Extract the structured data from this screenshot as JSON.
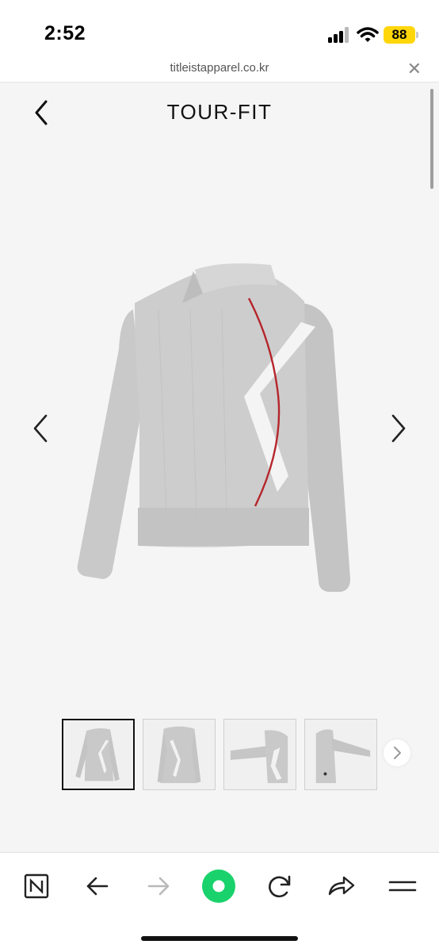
{
  "status_bar": {
    "time": "2:52",
    "battery": "88",
    "battery_color": "#ffd60a"
  },
  "browser": {
    "url": "titleistapparel.co.kr",
    "close_icon": "close-icon"
  },
  "header": {
    "title": "TOUR-FIT",
    "back_icon": "chevron-left-icon"
  },
  "gallery": {
    "product": "sweater",
    "prev_icon": "chevron-left-icon",
    "next_icon": "chevron-right-icon",
    "thumbnails": [
      {
        "view": "front",
        "active": true
      },
      {
        "view": "back",
        "active": false
      },
      {
        "view": "side-arm",
        "active": false
      },
      {
        "view": "side",
        "active": false
      }
    ],
    "more_icon": "chevron-right-icon"
  },
  "toolbar": {
    "items": [
      "naver-n-icon",
      "back-arrow-icon",
      "forward-arrow-icon",
      "green-dot-icon",
      "reload-icon",
      "share-icon",
      "menu-icon"
    ],
    "accent": "#19d26b"
  }
}
